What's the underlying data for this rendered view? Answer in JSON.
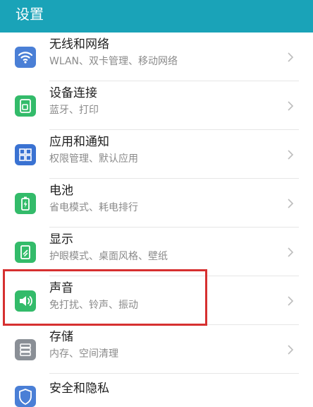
{
  "header": {
    "title": "设置"
  },
  "colors": {
    "header_bg": "#1aa3b8",
    "highlight_border": "#d63030"
  },
  "settings": [
    {
      "title": "无线和网络",
      "subtitle": "WLAN、双卡管理、移动网络",
      "icon": "wifi-icon",
      "color": "#4a7fd6"
    },
    {
      "title": "设备连接",
      "subtitle": "蓝牙、打印",
      "icon": "device-connection-icon",
      "color": "#33bb6a"
    },
    {
      "title": "应用和通知",
      "subtitle": "权限管理、默认应用",
      "icon": "apps-grid-icon",
      "color": "#3a72d2"
    },
    {
      "title": "电池",
      "subtitle": "省电模式、耗电排行",
      "icon": "battery-icon",
      "color": "#33bb6a"
    },
    {
      "title": "显示",
      "subtitle": "护眼模式、桌面风格、壁纸",
      "icon": "display-icon",
      "color": "#33bb6a"
    },
    {
      "title": "声音",
      "subtitle": "免打扰、铃声、振动",
      "icon": "sound-icon",
      "color": "#33bb6a"
    },
    {
      "title": "存储",
      "subtitle": "内存、空间清理",
      "icon": "storage-icon",
      "color": "#8a8f96"
    },
    {
      "title": "安全和隐私",
      "subtitle": "",
      "icon": "security-icon",
      "color": "#4a7fd6"
    }
  ]
}
